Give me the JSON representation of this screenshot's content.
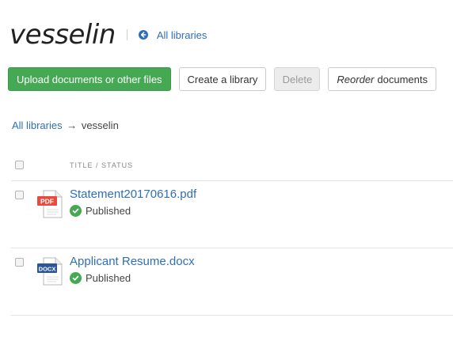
{
  "header": {
    "title": "vesselin",
    "back_link": "All libraries"
  },
  "toolbar": {
    "upload_label": "Upload documents or other files",
    "create_label": "Create a library",
    "delete_label": "Delete",
    "reorder_emphasis": "Reorder",
    "reorder_rest": "documents"
  },
  "breadcrumb": {
    "root": "All libraries",
    "separator": "→",
    "current": "vesselin"
  },
  "table": {
    "column_title": "TITLE / STATUS",
    "rows": [
      {
        "name": "Statement20170616.pdf",
        "status": "Published",
        "file_type": "PDF",
        "icon": "pdf-file-icon",
        "badge_color": "#e84a3c"
      },
      {
        "name": "Applicant Resume.docx",
        "status": "Published",
        "file_type": "DOCX",
        "icon": "docx-file-icon",
        "badge_color": "#2b579a"
      }
    ]
  },
  "colors": {
    "primary": "#45a954",
    "link": "#2f6fb5"
  }
}
